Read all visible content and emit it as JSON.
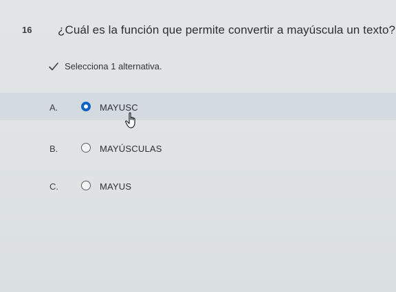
{
  "question": {
    "number": "16",
    "text": "¿Cuál es la función que permite convertir a mayúscula un texto?"
  },
  "instruction": {
    "icon": "checkmark-icon",
    "text": "Selecciona 1 alternativa."
  },
  "options": [
    {
      "letter": "A.",
      "label": "MAYUSC",
      "selected": true
    },
    {
      "letter": "B.",
      "label": "MAYÚSCULAS",
      "selected": false
    },
    {
      "letter": "C.",
      "label": "MAYUS",
      "selected": false
    }
  ],
  "colors": {
    "accent": "#0e63c4",
    "selected_row": "#c8d4dc"
  },
  "cursor": "hand-pointer-icon"
}
